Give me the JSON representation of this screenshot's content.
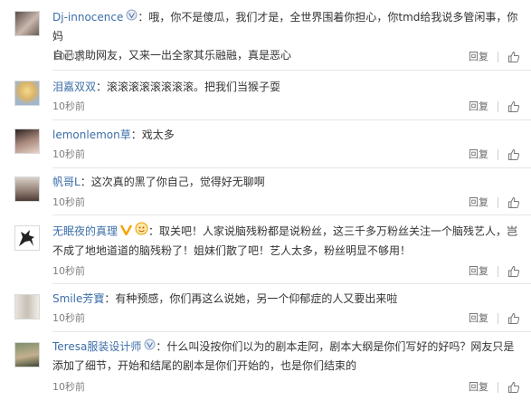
{
  "colors": {
    "name": "#3c6ea8",
    "text": "#333333",
    "meta": "#808080",
    "divider": "#e6e6e6"
  },
  "actions": {
    "reply": "回复"
  },
  "comments": [
    {
      "name": "Dj-innocence",
      "badge": "v-icon",
      "line1": "：哦，你不是傻瓜，我们才是，全世界围着你担心，你tmd给我说多管闲事，你妈",
      "line2": "自己求助网友，又来一出全家其乐融融，真是恶心",
      "time": "10秒前"
    },
    {
      "name": "泪嘉双双",
      "badge": "",
      "line1": "：滚滚滚滚滚滚滚滚。把我们当猴子耍",
      "line2": "",
      "time": "10秒前"
    },
    {
      "name": "lemonlemon草",
      "badge": "",
      "line1": "：戏太多",
      "line2": "",
      "time": "10秒前"
    },
    {
      "name": "帆哥L",
      "badge": "",
      "line1": "：这次真的黑了你自己，觉得好无聊啊",
      "line2": "",
      "time": "10秒前"
    },
    {
      "name": "无眠夜的真理",
      "badge": "vip-icon",
      "line1": "：取关吧！人家说脑残粉都是说粉丝，这三千多万粉丝关注一个脑残艺人，岂",
      "line2": "不成了地地道道的脑残粉了！姐妹们散了吧！艺人太多，粉丝明显不够用！",
      "time": "10秒前"
    },
    {
      "name": "Smile芳寶",
      "badge": "",
      "line1": "：有种预感，你们再这么说她，另一个仰郁症的人又要出来啦",
      "line2": "",
      "time": "10秒前"
    },
    {
      "name": "Teresa服装设计师",
      "badge": "v-icon",
      "line1": "：什么叫没按你们以为的剧本走阿，剧本大纲是你们写好的好吗？网友只是",
      "line2": "添加了细节，开始和结尾的剧本是你们开始的，也是你们结束的",
      "time": "10秒前"
    }
  ]
}
